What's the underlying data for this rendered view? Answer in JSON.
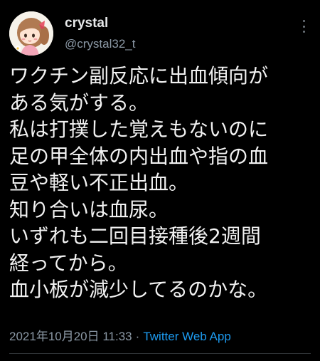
{
  "author": {
    "display_name": "crystal",
    "handle": "@crystal32_t",
    "avatar_icon": "anime-girl-avatar-icon"
  },
  "more_icon": "more-horizontal-icon",
  "tweet": {
    "lines": [
      "ワクチン副反応に出血傾向が",
      "ある気がする。",
      "私は打撲した覚えもないのに",
      "足の甲全体の内出血や指の血",
      "豆や軽い不正出血。",
      "知り合いは血尿。",
      "いずれも二回目接種後2週間",
      "経ってから。",
      "血小板が減少してるのかな。"
    ]
  },
  "meta": {
    "timestamp": "2021年10月20日 11:33",
    "separator": "·",
    "source": "Twitter Web App"
  },
  "colors": {
    "background": "#000000",
    "text": "#e7e9ea",
    "secondary": "#8b98a5",
    "accent": "#1d9bf0",
    "divider": "#2f3336"
  }
}
